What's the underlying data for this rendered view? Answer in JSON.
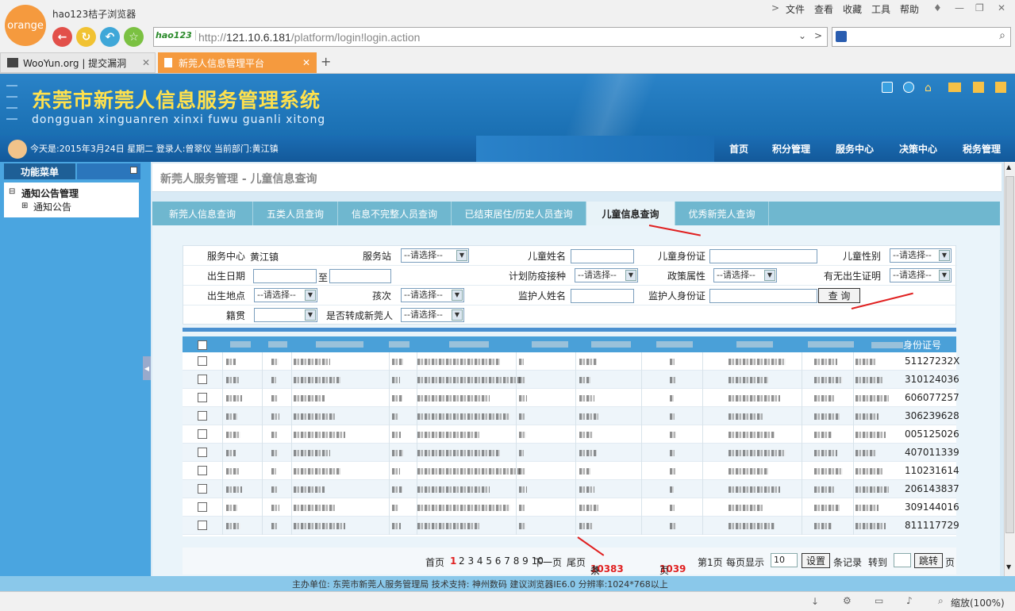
{
  "browser": {
    "logo_text": "orange",
    "name": "hao123桔子浏览器",
    "menu": [
      "文件",
      "查看",
      "收藏",
      "工具",
      "帮助"
    ],
    "address_badge": "hao123",
    "url_prefix": "http://",
    "url_host": "121.10.6.181",
    "url_path": "/platform/login!login.action",
    "tabs": [
      {
        "label": "WooYun.org | 提交漏洞"
      },
      {
        "label": "新莞人信息管理平台"
      }
    ],
    "new_tab": "+",
    "zoom": "缩放(100%)"
  },
  "header": {
    "title_cn": "东莞市新莞人信息服务管理系统",
    "title_en": "dongguan xinguanren xinxi fuwu guanli xitong"
  },
  "infobar": {
    "text": "今天是:2015年3月24日  星期二  登录人:曾翠仪  当前部门:黄江镇",
    "nav": [
      "首页",
      "积分管理",
      "服务中心",
      "决策中心",
      "税务管理"
    ]
  },
  "sidebar": {
    "title": "功能菜单",
    "group": "通知公告管理",
    "item": "通知公告"
  },
  "breadcrumb": "新莞人服务管理 - 儿童信息查询",
  "page_tabs": [
    "新莞人信息查询",
    "五类人员查询",
    "信息不完整人员查询",
    "已结束居住/历史人员查询",
    "儿童信息查询",
    "优秀新莞人查询"
  ],
  "form": {
    "service_center_label": "服务中心",
    "service_center_value": "黄江镇",
    "service_station_label": "服务站",
    "select_placeholder": "--请选择--",
    "child_name_label": "儿童姓名",
    "child_id_label": "儿童身份证",
    "child_gender_label": "儿童性别",
    "birth_date_label": "出生日期",
    "to_label": "至",
    "vaccination_label": "计划防疫接种",
    "policy_label": "政策属性",
    "birth_cert_label": "有无出生证明",
    "birth_place_label": "出生地点",
    "birth_order_label": "孩次",
    "guardian_name_label": "监护人姓名",
    "guardian_id_label": "监护人身份证",
    "query_button": "查 询",
    "native_label": "籍贯",
    "converted_label": "是否转成新莞人"
  },
  "table": {
    "last_header": "身份证号",
    "rows": [
      {
        "id": "51127232X"
      },
      {
        "id": "310124036"
      },
      {
        "id": "606077257"
      },
      {
        "id": "306239628"
      },
      {
        "id": "005125026"
      },
      {
        "id": "407011339"
      },
      {
        "id": "110231614"
      },
      {
        "id": "206143837"
      },
      {
        "id": "309144016"
      },
      {
        "id": "811117729"
      }
    ]
  },
  "pager": {
    "first": "首页",
    "current": "1",
    "pages": "2 3 4 5 6 7 8 9 10",
    "next": "下一页",
    "last": "尾页",
    "total_prefix": "共",
    "total": "10383",
    "total_suffix": "条记录",
    "page_count": "1039",
    "page_suffix": "页",
    "current_page_text": "第1页",
    "per_page_label": "每页显示",
    "per_page_value": "10",
    "set_button": "设置",
    "records_label": "条记录",
    "goto_label": "转到",
    "jump_button": "跳转",
    "page_unit": "页"
  },
  "footer": "主办单位: 东莞市新莞人服务管理局    技术支持: 神州数码    建议浏览器IE6.0  分辨率:1024*768以上",
  "colors": {
    "header": "#1a6fb2",
    "title": "#ffe14d",
    "tab_active": "#f59a3e",
    "accent_red": "#e02020"
  }
}
